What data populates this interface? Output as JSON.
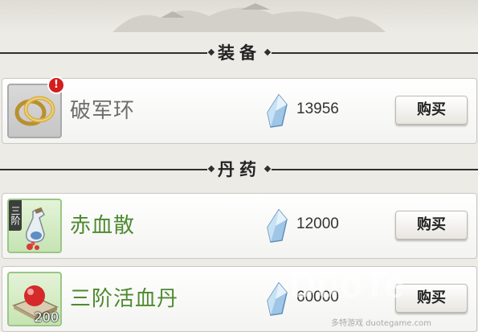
{
  "sections": {
    "equipment": {
      "title": "装备",
      "items": [
        {
          "name": "破军环",
          "price": "13956",
          "buy_label": "购买",
          "icon": "gold-rings-icon",
          "alert": "!"
        }
      ]
    },
    "elixirs": {
      "title": "丹药",
      "items": [
        {
          "name": "赤血散",
          "price": "12000",
          "buy_label": "购买",
          "icon": "medicine-bottle-icon",
          "tier": "三阶"
        },
        {
          "name": "三阶活血丹",
          "price": "60000",
          "buy_label": "购买",
          "icon": "red-pill-icon",
          "quantity": "200"
        }
      ]
    }
  },
  "currency_icon": "blue-crystal-icon",
  "watermark": {
    "text": "DuoTe",
    "sub": "多特游戏 duotegame.com"
  },
  "colors": {
    "background": "#ecebe6",
    "equipment_name": "#6e6e6e",
    "elixir_name": "#4d8a2e",
    "alert": "#d41d1d"
  }
}
